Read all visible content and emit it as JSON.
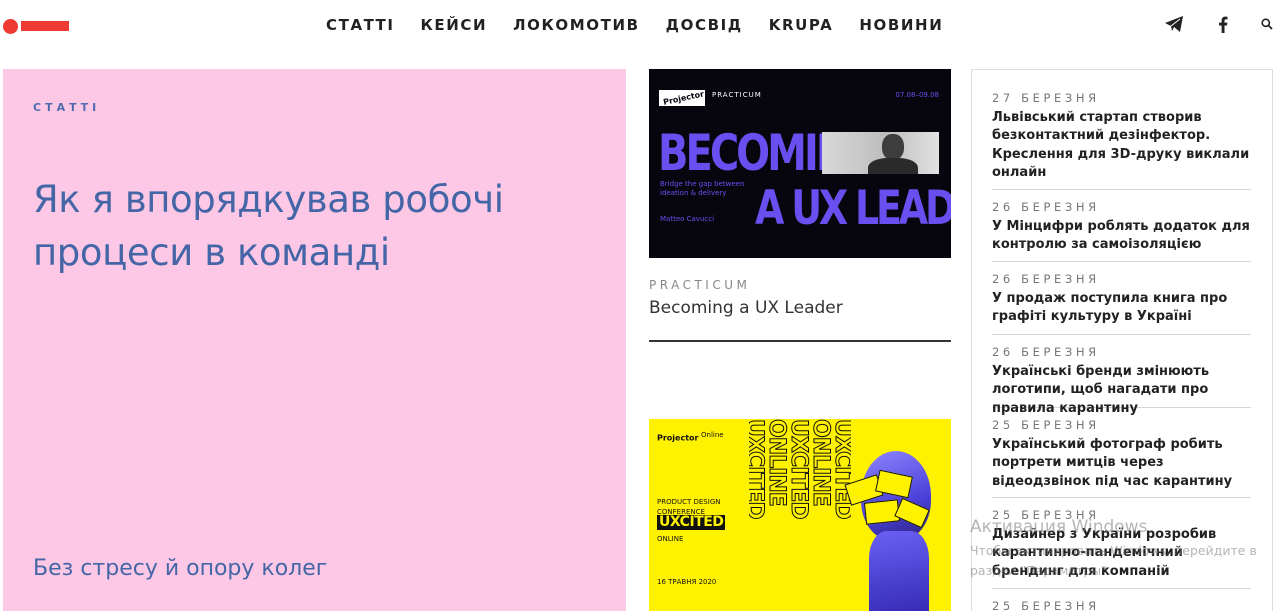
{
  "header": {
    "nav": [
      "СТАТТІ",
      "КЕЙСИ",
      "ЛОКОМОТИВ",
      "ДОСВІД",
      "KRUPA",
      "НОВИНИ"
    ]
  },
  "hero": {
    "category": "СТАТТІ",
    "title": "Як я впорядкував робочі процеси в команді",
    "subtitle": "Без стресу й опору колег"
  },
  "cards": [
    {
      "image": {
        "brand": "Projector",
        "label": "PRACTICUM",
        "dates": "07.08–09.08",
        "headline1": "BECOMING",
        "headline2": "A UX LEADER",
        "tagline": "Bridge the gap between ideation & delivery",
        "speaker": "Matteo Cavucci"
      },
      "category": "PRACTICUM",
      "title": "Becoming a UX Leader"
    },
    {
      "image": {
        "brand": "Projector",
        "brand_suffix": "Online",
        "conf": "PRODUCT DESIGN CONFERENCE",
        "name": "UXCITED",
        "mode": "ONLINE",
        "date": "16 ТРАВНЯ 2020",
        "repeat": "UXCITED ONLINE"
      }
    }
  ],
  "news": [
    {
      "date": "27 БЕРЕЗНЯ",
      "title": "Львівський стартап створив безконтактний дезінфектор. Креслення для 3D-друку виклали онлайн"
    },
    {
      "date": "26 БЕРЕЗНЯ",
      "title": "У Мінцифри роблять додаток для контролю за самоізоляцією"
    },
    {
      "date": "26 БЕРЕЗНЯ",
      "title": "У продаж поступила книга про графіті культуру в Україні"
    },
    {
      "date": "26 БЕРЕЗНЯ",
      "title": "Українські бренди змінюють логотипи, щоб нагадати про правила карантину"
    },
    {
      "date": "25 БЕРЕЗНЯ",
      "title": "Український фотограф робить портрети митців через відеодзвінок під час карантину"
    },
    {
      "date": "25 БЕРЕЗНЯ",
      "title": "Дизайнер з України розробив карантинно-пандемічний брендинг для компаній"
    },
    {
      "date": "25 БЕРЕЗНЯ",
      "title": ""
    }
  ],
  "watermark": {
    "title": "Активация Windows",
    "text": "Чтобы активировать Windows, перейдите в раздел \"Параметры\"."
  },
  "colors": {
    "accent": "#ee3b34",
    "hero_bg": "#fdc8e6",
    "hero_text": "#4466a6",
    "purple": "#6a4ff0",
    "yellow": "#fff200"
  },
  "icons": [
    "telegram-icon",
    "facebook-icon",
    "search-icon"
  ]
}
